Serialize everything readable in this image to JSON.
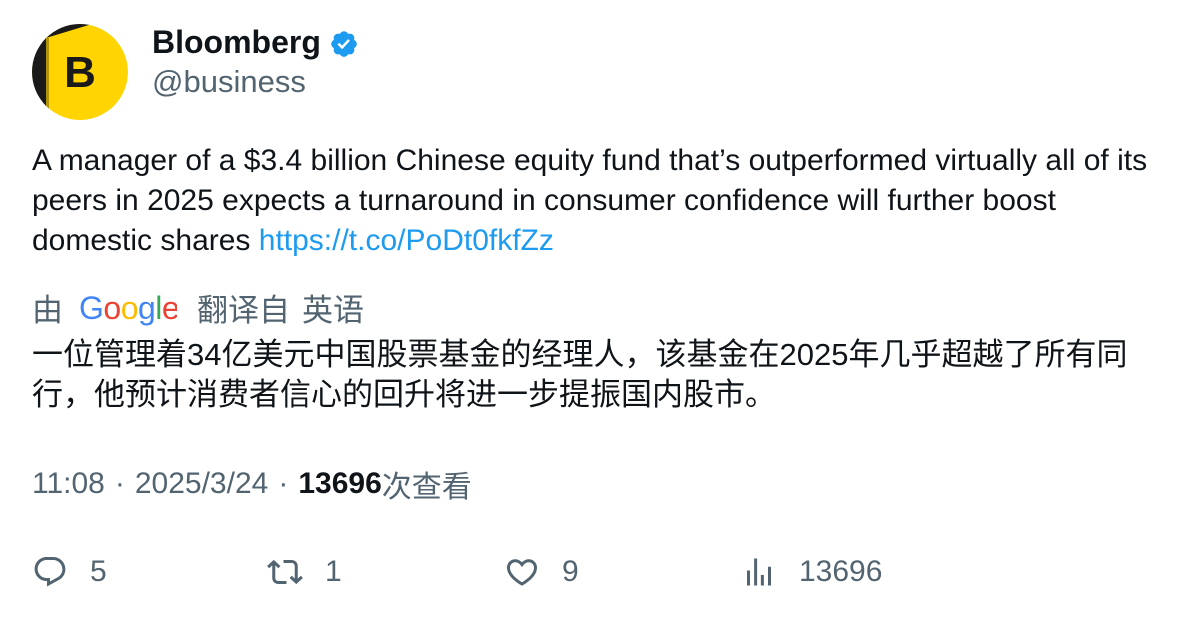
{
  "author": {
    "name": "Bloomberg",
    "handle": "@business",
    "avatar_letter": "B",
    "avatar_colors": {
      "background": "#ffd400",
      "dark": "#1a1a1a"
    },
    "verified_icon": "verified-badge",
    "verified_color": "#1d9bf0"
  },
  "tweet": {
    "text": "A manager of a $3.4 billion Chinese equity fund that’s outperformed virtually all of its peers in 2025 expects a turnaround in consumer confidence will further boost domestic shares ",
    "link": "https://t.co/PoDt0fkfZz",
    "link_color": "#1d9bf0"
  },
  "translation": {
    "by_label": "由",
    "provider": "Google",
    "translated_from_label": "翻译自",
    "source_language": "英语",
    "text": "一位管理着34亿美元中国股票基金的经理人，该基金在2025年几乎超越了所有同行，他预计消费者信心的回升将进一步提振国内股市。"
  },
  "meta": {
    "time": "11:08",
    "separator": "·",
    "date": "2025/3/24",
    "views_count": "13696",
    "views_label": "次查看"
  },
  "actions": {
    "reply": {
      "icon": "reply-icon",
      "count": "5"
    },
    "retweet": {
      "icon": "retweet-icon",
      "count": "1"
    },
    "like": {
      "icon": "like-icon",
      "count": "9"
    },
    "views": {
      "icon": "analytics-icon",
      "count": "13696"
    }
  },
  "colors": {
    "text": "#0f1419",
    "secondary": "#536471",
    "accent": "#1d9bf0"
  }
}
